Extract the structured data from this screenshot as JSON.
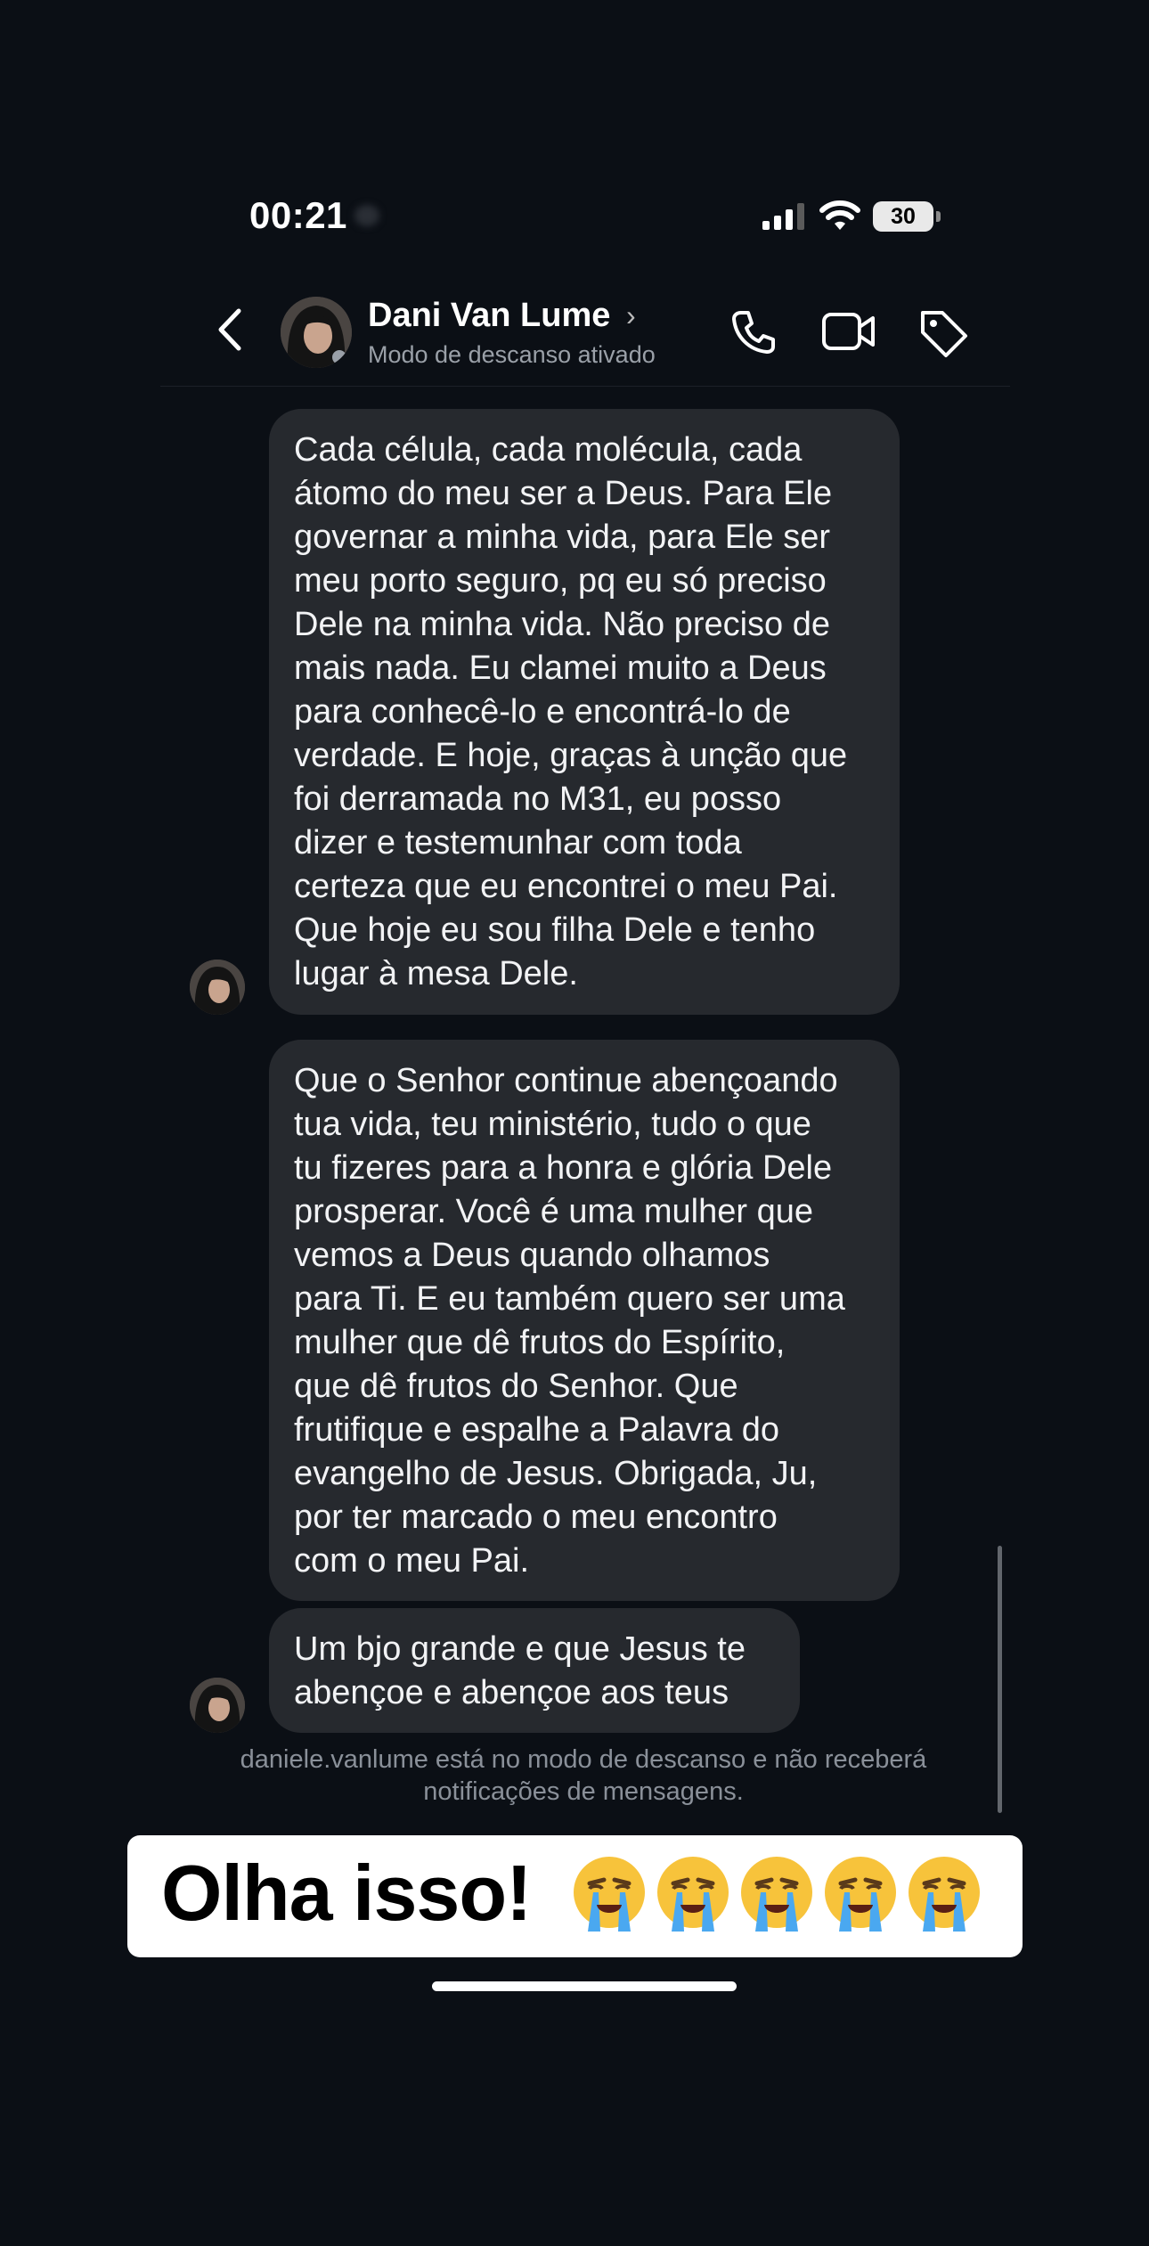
{
  "status_bar": {
    "time": "00:21",
    "battery": "30"
  },
  "header": {
    "name": "Dani Van Lume",
    "chevron": "›",
    "status": "Modo de descanso ativado"
  },
  "messages": [
    {
      "text": "Cada célula, cada molécula, cada\nátomo do meu ser a Deus. Para Ele\ngovernar a minha vida, para Ele ser\nmeu porto seguro, pq eu só preciso\nDele na minha vida. Não preciso de\nmais nada. Eu clamei muito a Deus\npara conhecê-lo e encontrá-lo de\nverdade. E hoje, graças à unção que\nfoi derramada no M31, eu posso\ndizer e testemunhar com toda\ncerteza que eu encontrei o meu Pai.\nQue hoje eu sou filha Dele e tenho\nlugar à mesa Dele."
    },
    {
      "text": "Que o Senhor continue abençoando\ntua vida, teu ministério, tudo o que\ntu fizeres para a honra e glória Dele\nprosperar. Você é uma mulher que\nvemos a Deus quando olhamos\npara Ti. E eu também quero ser uma\nmulher que dê frutos do Espírito,\nque dê frutos do Senhor. Que\nfrutifique e espalhe a Palavra do\nevangelho de Jesus. Obrigada, Ju,\npor ter marcado o meu encontro\ncom o meu Pai."
    },
    {
      "text": "Um bjo grande e que Jesus te\nabençoe e abençoe aos teus"
    }
  ],
  "notice": "daniele.vanlume está no modo de descanso e não receberá\nnotificações de mensagens.",
  "sticker": {
    "text": "Olha isso!",
    "emoji_count": 5,
    "emoji_name": "loudly-crying-face"
  }
}
